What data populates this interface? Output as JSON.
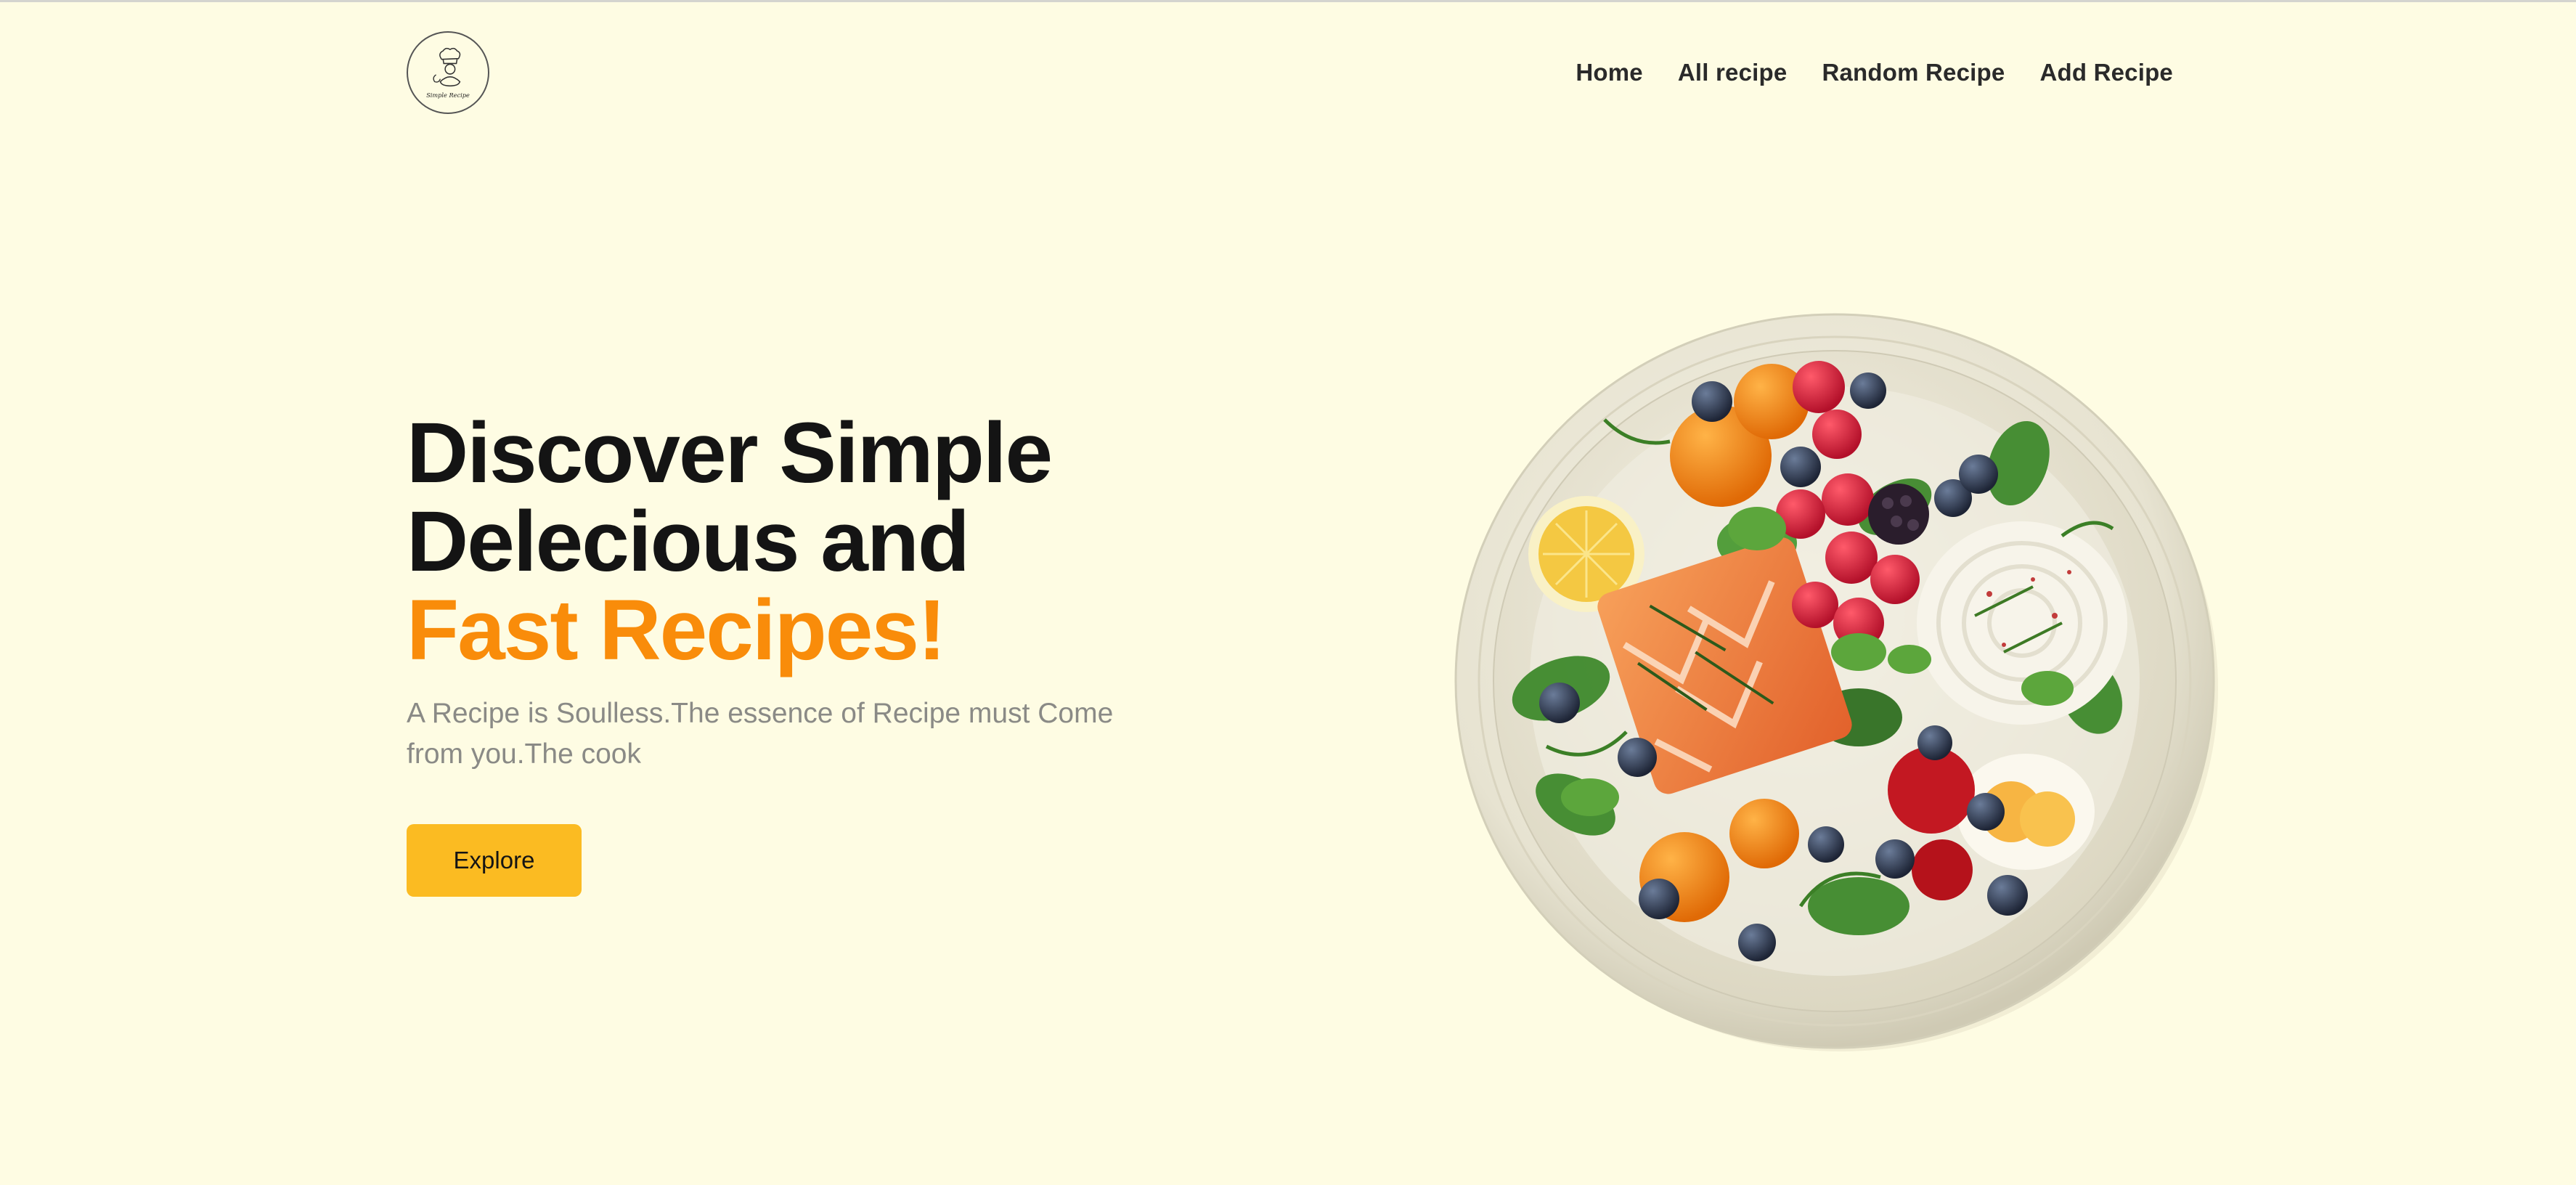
{
  "header": {
    "logo_icon": "chef-logo-icon",
    "logo_text": "Simple Recipe",
    "nav": [
      {
        "label": "Home"
      },
      {
        "label": "All recipe"
      },
      {
        "label": "Random Recipe"
      },
      {
        "label": "Add Recipe"
      }
    ]
  },
  "hero": {
    "headline_line1": "Discover Simple",
    "headline_line2": "Delecious and",
    "headline_accent": "Fast Recipes!",
    "subtext": "A Recipe is Soulless.The essence of Recipe must Come from you.The cook",
    "button_label": "Explore",
    "image": "salmon-plate-image"
  },
  "colors": {
    "background": "#fefce3",
    "accent": "#f98c0a",
    "button": "#fbbb22",
    "heading": "#141414",
    "subtext": "#8a8a86"
  }
}
